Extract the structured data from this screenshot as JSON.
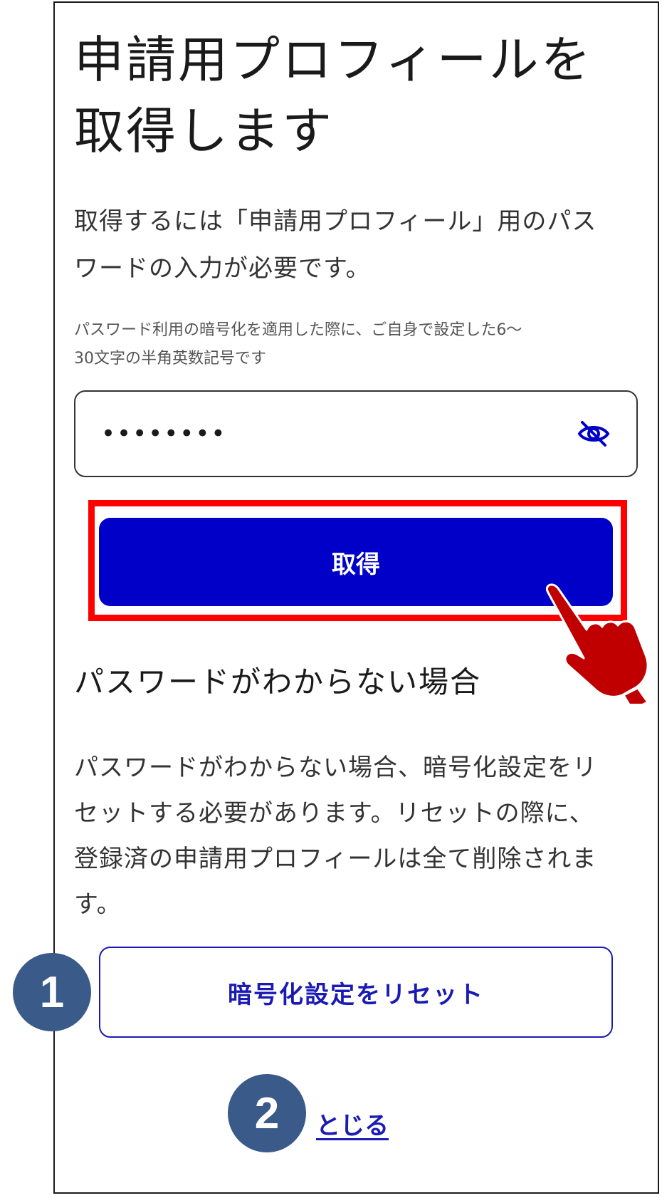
{
  "screen": {
    "title_lines": [
      "申請用プロフィールを",
      "取得します"
    ],
    "lead_lines": [
      "取得するには「申請用プロフィール」用のパス",
      "ワードの入力が必要です。"
    ],
    "hint_lines": [
      "パスワード利用の暗号化を適用した際に、ご自身で設定した6～",
      "30文字の半角英数記号です"
    ],
    "password_field": {
      "value": "••••••••",
      "toggle_icon": "eye-slash-icon"
    },
    "submit_button": {
      "label": "取得"
    },
    "forgot_section": {
      "heading": "パスワードがわからない場合",
      "body_lines": [
        "パスワードがわからない場合、暗号化設定をリ",
        "セットする必要があります。リセットの際に、",
        "登録済の申請用プロフィールは全て削除されま",
        "す。"
      ]
    },
    "reset_button": {
      "label": "暗号化設定をリセット"
    },
    "close_link": {
      "label": "とじる"
    }
  },
  "annotations": {
    "callout_1": "1",
    "callout_2": "2",
    "highlight_color": "#ff0000",
    "callout_color": "#3a5a8a",
    "pointer_icon": "pointing-hand-icon",
    "pointer_color": "#c00000"
  },
  "colors": {
    "primary": "#0000c8",
    "link": "#1a1ab4"
  }
}
